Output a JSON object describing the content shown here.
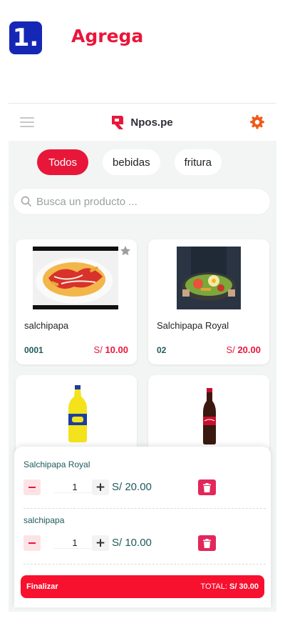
{
  "step": {
    "number": "1.",
    "title": "Agrega"
  },
  "app": {
    "name": "Npos.pe"
  },
  "categories": [
    {
      "label": "Todos",
      "active": true
    },
    {
      "label": "bebidas",
      "active": false
    },
    {
      "label": "fritura",
      "active": false
    }
  ],
  "search": {
    "placeholder": "Busca un producto ..."
  },
  "products": [
    {
      "name": "salchipapa",
      "code": "0001",
      "currency": "S/",
      "price": "10.00"
    },
    {
      "name": "Salchipapa Royal",
      "code": "02",
      "currency": "S/",
      "price": "20.00"
    },
    {
      "name": "",
      "code": "",
      "currency": "",
      "price": ""
    },
    {
      "name": "",
      "code": "",
      "currency": "",
      "price": ""
    }
  ],
  "cart": {
    "items": [
      {
        "name": "Salchipapa Royal",
        "qty": "1",
        "price": "S/ 20.00"
      },
      {
        "name": "salchipapa",
        "qty": "1",
        "price": "S/ 10.00"
      }
    ],
    "finalize_label": "Finalizar",
    "total_label": "TOTAL:",
    "total_value": "S/ 30.00"
  },
  "colors": {
    "accent": "#e8173a",
    "step_badge": "#1727b5",
    "gear": "#f05a1a",
    "text_teal": "#1f5a5a"
  }
}
